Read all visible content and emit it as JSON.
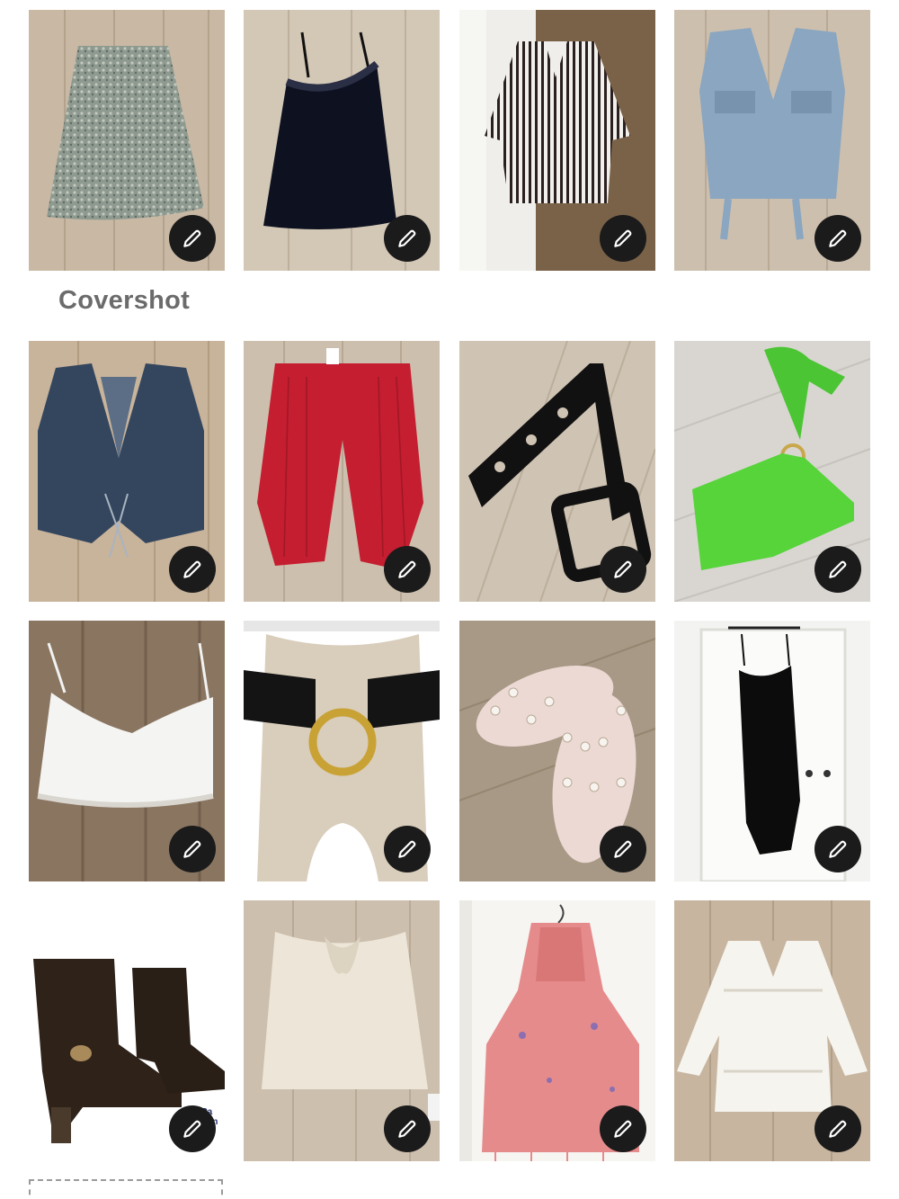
{
  "covershot_label": "Covershot",
  "edit_icon": "pencil-icon",
  "photos": [
    {
      "name": "floral-midi-skirt",
      "alt": "Floral midi skirt"
    },
    {
      "name": "black-lace-slip-dress",
      "alt": "Black lace slip dress"
    },
    {
      "name": "striped-button-shirt",
      "alt": "Striped button shirt"
    },
    {
      "name": "light-denim-vest",
      "alt": "Light denim vest"
    },
    {
      "name": "dark-denim-lace-up-vest",
      "alt": "Dark denim lace-up vest"
    },
    {
      "name": "red-knit-pants",
      "alt": "Red knit pants"
    },
    {
      "name": "black-leather-belt",
      "alt": "Black leather belt"
    },
    {
      "name": "green-crochet-halter-top",
      "alt": "Green crochet halter top"
    },
    {
      "name": "white-lace-cami",
      "alt": "White lace cami"
    },
    {
      "name": "black-ring-belt",
      "alt": "Black ring belt"
    },
    {
      "name": "pearl-jelly-sandals",
      "alt": "Pearl jelly sandals"
    },
    {
      "name": "black-satin-slip-dress",
      "alt": "Black satin slip dress"
    },
    {
      "name": "brown-suede-boots",
      "alt": "Brown suede boots"
    },
    {
      "name": "cream-twist-tube-top",
      "alt": "Cream twist tube top"
    },
    {
      "name": "pink-knit-poncho",
      "alt": "Pink knit poncho"
    },
    {
      "name": "white-crochet-tunic",
      "alt": "White crochet tunic"
    }
  ],
  "boots_brand_text": "Pa      oon"
}
